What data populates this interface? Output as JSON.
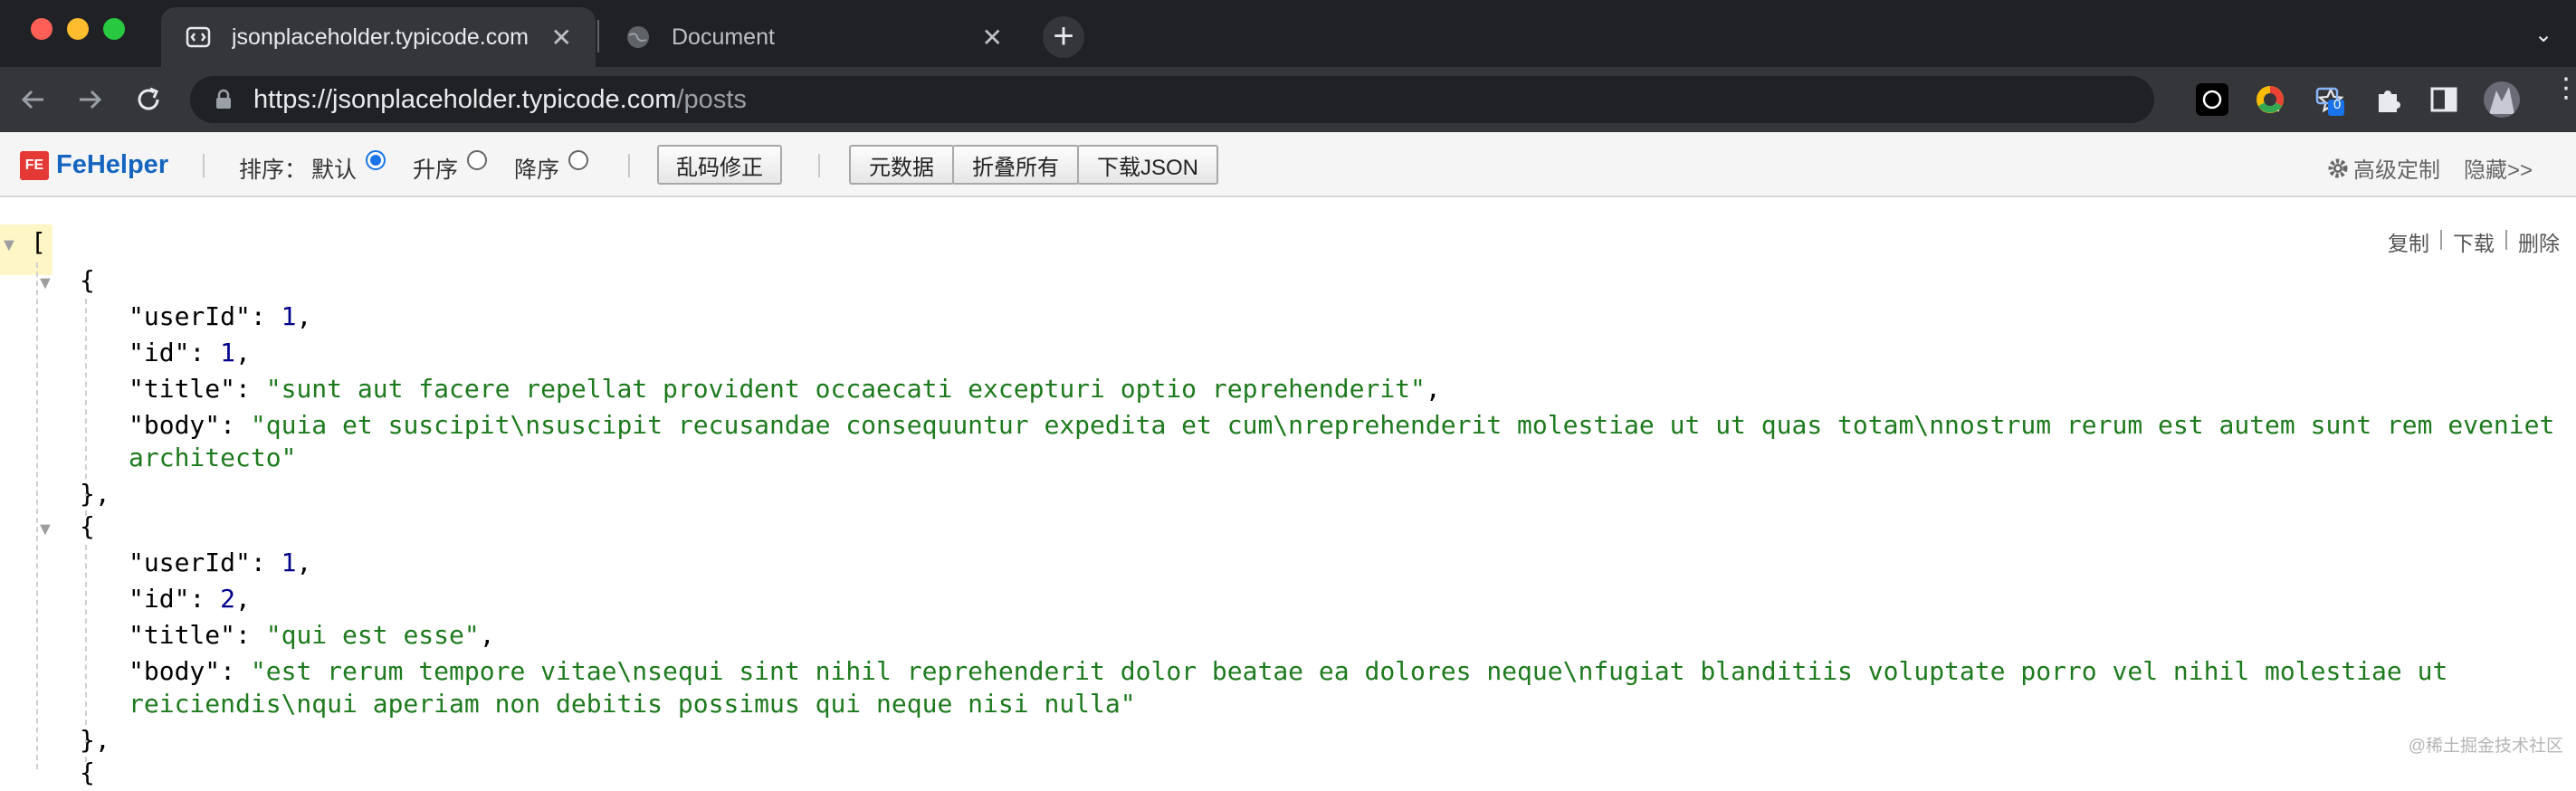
{
  "browser": {
    "tabs": [
      {
        "title": "jsonplaceholder.typicode.com",
        "active": true
      },
      {
        "title": "Document",
        "active": false
      }
    ],
    "new_tab_label": "+",
    "close_glyph": "✕",
    "address": {
      "host": "https://jsonplaceholder.typicode.com",
      "path": "/posts"
    },
    "extension_badge": "0"
  },
  "fehelper": {
    "logo_badge": "FE",
    "logo": "FeHelper",
    "sort_label": "排序：",
    "sort_default": "默认",
    "sort_asc": "升序",
    "sort_desc": "降序",
    "fix_encoding": "乱码修正",
    "metadata": "元数据",
    "collapse_all": "折叠所有",
    "download_json": "下载JSON",
    "advanced": "高级定制",
    "hide": "隐藏>>"
  },
  "viewer_actions": {
    "copy": "复制",
    "download": "下载",
    "delete": "删除",
    "divider": "|"
  },
  "json": {
    "open_bracket": "[",
    "posts": [
      {
        "open": "{",
        "userId_key": "\"userId\"",
        "userId": "1",
        "id_key": "\"id\"",
        "id": "1",
        "title_key": "\"title\"",
        "title": "\"sunt aut facere repellat provident occaecati excepturi optio reprehenderit\"",
        "body_key": "\"body\"",
        "body_line1": "\"quia et suscipit\\nsuscipit recusandae consequuntur expedita et cum\\nreprehenderit molestiae ut ut quas totam\\nnostrum rerum est autem sunt rem eveniet",
        "body_line2": "architecto\"",
        "close": "},"
      },
      {
        "open": "{",
        "userId_key": "\"userId\"",
        "userId": "1",
        "id_key": "\"id\"",
        "id": "2",
        "title_key": "\"title\"",
        "title": "\"qui est esse\"",
        "body_key": "\"body\"",
        "body_line1": "\"est rerum tempore vitae\\nsequi sint nihil reprehenderit dolor beatae ea dolores neque\\nfugiat blanditiis voluptate porro vel nihil molestiae ut",
        "body_line2": "reiciendis\\nqui aperiam non debitis possimus qui neque nisi nulla\"",
        "close": "},"
      }
    ],
    "next_open": "{"
  },
  "watermark": "@稀土掘金技术社区",
  "colors": {
    "key": "#000000",
    "number": "#00008b",
    "string": "#1e7a1e",
    "accent": "#1a73e8"
  }
}
